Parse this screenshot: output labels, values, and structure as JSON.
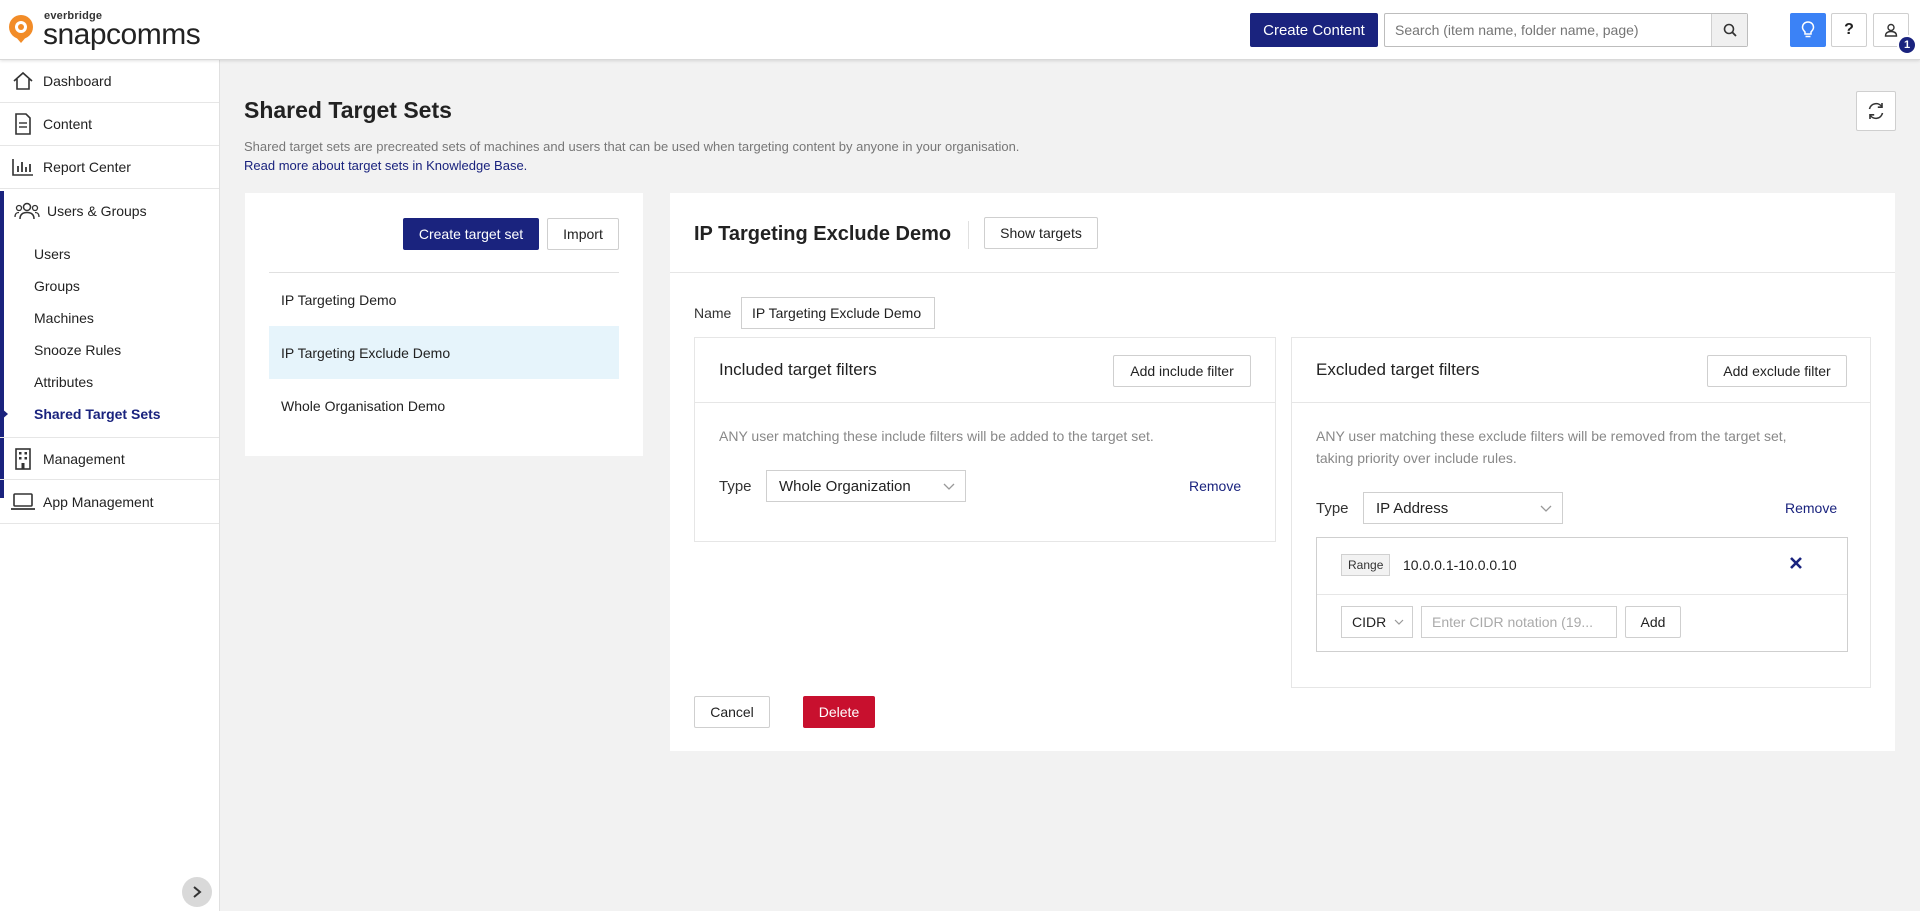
{
  "brand": {
    "small": "everbridge",
    "big": "snapcomms",
    "accent": "#f28c28",
    "primary": "#1a237e"
  },
  "header": {
    "create_content": "Create Content",
    "search_placeholder": "Search (item name, folder name, page)",
    "notification_count": "1",
    "help_label": "?"
  },
  "sidebar": {
    "items": [
      {
        "label": "Dashboard",
        "icon": "home-icon"
      },
      {
        "label": "Content",
        "icon": "document-icon"
      },
      {
        "label": "Report Center",
        "icon": "bar-chart-icon"
      },
      {
        "label": "Users & Groups",
        "icon": "users-icon"
      },
      {
        "label": "Management",
        "icon": "building-icon"
      },
      {
        "label": "App Management",
        "icon": "laptop-icon"
      }
    ],
    "sub_items": [
      "Users",
      "Groups",
      "Machines",
      "Snooze Rules",
      "Attributes",
      "Shared Target Sets"
    ]
  },
  "page": {
    "title": "Shared Target Sets",
    "description": "Shared target sets are precreated sets of machines and users that can be used when targeting content by anyone in your organisation.",
    "link": "Read more about target sets in Knowledge Base."
  },
  "list_panel": {
    "create_label": "Create target set",
    "import_label": "Import",
    "items": [
      "IP Targeting Demo",
      "IP Targeting Exclude Demo",
      "Whole Organisation Demo"
    ]
  },
  "detail": {
    "title": "IP Targeting Exclude Demo",
    "show_targets": "Show targets",
    "name_label": "Name",
    "name_value": "IP Targeting Exclude Demo",
    "included": {
      "title": "Included target filters",
      "add_label": "Add include filter",
      "description": "ANY user matching these include filters will be added to the target set.",
      "type_label": "Type",
      "type_value": "Whole Organization",
      "remove_label": "Remove"
    },
    "excluded": {
      "title": "Excluded target filters",
      "add_label": "Add exclude filter",
      "description_line1": "ANY user matching these exclude filters will be removed from the target set,",
      "description_line2": "taking priority over include rules.",
      "type_label": "Type",
      "type_value": "IP Address",
      "remove_label": "Remove",
      "range_tag": "Range",
      "range_value": "10.0.0.1-10.0.0.10",
      "cidr_label": "CIDR",
      "cidr_placeholder": "Enter CIDR notation (19...",
      "add_label_small": "Add"
    },
    "cancel_label": "Cancel",
    "delete_label": "Delete"
  }
}
